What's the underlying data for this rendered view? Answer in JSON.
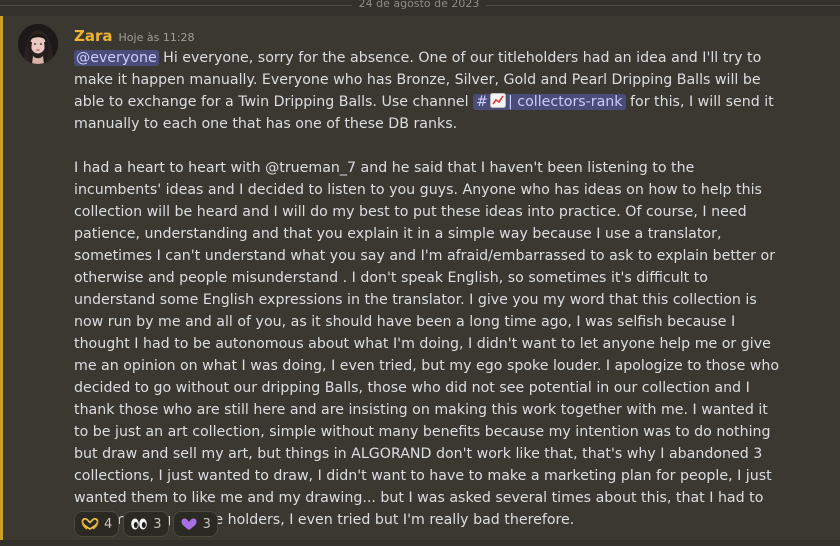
{
  "date_divider": "24 de agosto de 2023",
  "message": {
    "author": "Zara",
    "timestamp": "Hoje às 11:28",
    "mention": "@everyone",
    "p1_before_channel": " Hi everyone, sorry for the absence.  One of our titleholders had an idea and I'll try to make it happen manually.  Everyone who has Bronze, Silver, Gold and Pearl Dripping Balls will be able to exchange for a Twin Dripping Balls.  Use channel ",
    "channel_hash": "#",
    "channel_name": "| collectors-rank",
    "p1_after_channel": " for this, I will send it manually to each one that has one of these DB ranks.",
    "p2": "I had a heart to heart with @trueman_7 and he said that I haven't been listening to the incumbents' ideas and I decided to listen to you guys.  Anyone who has ideas on how to help this collection will be heard and I will do my best to put these ideas into practice.  Of course, I need patience, understanding and that you explain it in a simple way because I use a translator, sometimes I can't understand what you say and I'm afraid/embarrassed to ask to explain better or otherwise and people misunderstand .  I don't speak English, so sometimes it's difficult to understand some English expressions in the translator.  I give you my word that this collection is now run by me and all of you, as it should have been a long time ago, I was selfish because I thought I had to be autonomous about what I'm doing, I didn't want to let anyone help me or give me an opinion on what I was doing, I even tried, but my ego spoke louder.  I apologize to those who decided to go without our dripping Balls, those who did not see potential in our collection and I thank those who are still here and are insisting on making this work together with me.  I wanted it to be just an art collection, simple without many benefits because my intention was to do nothing but draw and sell my art, but things in ALGORAND don't work like that, that's why I abandoned 3 collections, I just wanted to draw, I didn't want to have to make a marketing plan for people, I just wanted them to like me and my drawing... but I was asked several times about this, that I had to do something for the holders, I even tried but I'm really bad therefore."
  },
  "reactions": [
    {
      "icon": "heart-hands-icon",
      "count": "4"
    },
    {
      "icon": "eyes-icon",
      "count": "3"
    },
    {
      "icon": "purple-heart-icon",
      "count": "3"
    }
  ],
  "colors": {
    "background": "#33312c",
    "message_highlight": "#3a3830",
    "accent_bar": "#c9a227",
    "username": "#f0b232",
    "mention_bg": "#4a4d7a",
    "mention_text": "#c9cdfb"
  }
}
